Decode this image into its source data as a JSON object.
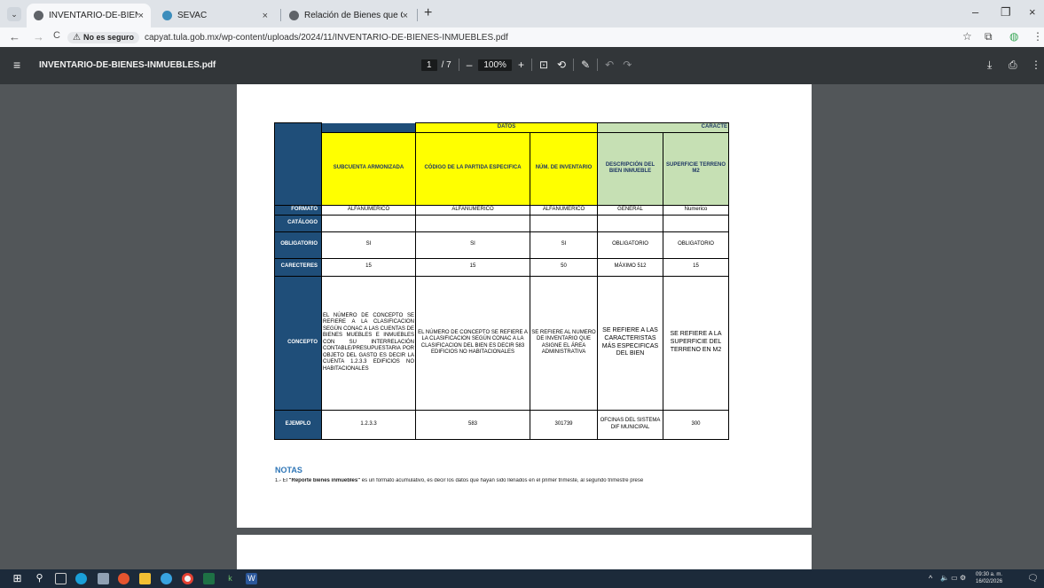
{
  "browser": {
    "tabs": [
      {
        "title": "INVENTARIO-DE-BIENES-INMU",
        "close": "×",
        "favicon_color": "#5f6368",
        "active": true
      },
      {
        "title": "SEVAC",
        "close": "×",
        "favicon_color": "#3c8dbc",
        "active": false
      },
      {
        "title": "Relación de Bienes que Compo",
        "close": "×",
        "favicon_color": "#5f6368",
        "active": false
      }
    ],
    "new_tab": "+",
    "window_controls": {
      "minimize": "–",
      "restore": "❐",
      "close": "×"
    },
    "nav": {
      "back": "←",
      "forward": "→",
      "reload": "C"
    },
    "security_chip": {
      "icon": "⚠",
      "label": "No es seguro"
    },
    "url": "capyat.tula.gob.mx/wp-content/uploads/2024/11/INVENTARIO-DE-BIENES-INMUEBLES.pdf",
    "toolbar_icons": {
      "star": "☆",
      "extensions": "⧉",
      "profile": "◍",
      "menu": "⋮"
    }
  },
  "pdf_viewer": {
    "menu_icon": "≡",
    "filename": "INVENTARIO-DE-BIENES-INMUEBLES.pdf",
    "page_current": "1",
    "page_total": "/ 7",
    "zoom_out": "–",
    "zoom": "100%",
    "zoom_in": "+",
    "fit_icon": "⊡",
    "rotate_icon": "⟲",
    "annotate_icon": "✎",
    "undo_icon": "↶",
    "redo_icon": "↷",
    "download_icon": "⤓",
    "print_icon": "⎙",
    "more_icon": "⋮"
  },
  "document": {
    "group_header_datos": "DATOS",
    "group_header_caract": "CARACTE",
    "columns": [
      "SUBCUENTA ARMONIZADA",
      "CÓDIGO DE LA PARTIDA ESPECIFICA",
      "NÚM. DE INVENTARIO",
      "DESCRIPCIÓN DEL BIEN INMUEBLE",
      "SUPERFICIE TERRENO M2"
    ],
    "rows": [
      {
        "label": "FORMATO",
        "cells": [
          "ALFANÚMERICO",
          "ALFANÚMERICO",
          "ALFANÚMERICO",
          "GENERAL",
          "Numerico"
        ]
      },
      {
        "label": "CATÁLOGO",
        "cells": [
          "",
          "",
          "",
          "",
          ""
        ]
      },
      {
        "label": "OBLIGATORIO",
        "cells": [
          "SI",
          "SI",
          "SI",
          "OBLIGATORIO",
          "OBLIGATORIO"
        ]
      },
      {
        "label": "CARECTERES",
        "cells": [
          "15",
          "15",
          "50",
          "MÁXIMO 512",
          "15"
        ]
      },
      {
        "label": "CONCEPTO",
        "cells": [
          "EL NÚMERO DE CONCEPTO SE REFIERE A LA CLASIFICACION SEGÚN CONAC A LAS CUENTAS DE BIENES MUEBLES E INMUEBLES CON SU INTERRELACIÓN CONTABLE/PRESUPUESTARIA POR OBJETO DEL GASTO ES DECIR LA CUENTA 1.2.3.3 EDIFICIOS NO HABITACIONALES",
          "EL NÚMERO DE CONCEPTO SE REFIERE A LA CLASIFICACION SEGÚN CONAC A LA CLASIFICACION DEL BIEN ES DECIR 583 EDIFICIOS NO HABITACIONALES",
          "SE REFIERE AL NUMERO DE INVENTARIO QUE ASIGNE EL ÁREA ADMINISTRATIVA",
          "SE REFIERE A LAS CARACTERISTAS MÁS ESPECIFICAS DEL BIEN",
          "SE REFIERE A LA SUPERFICIE DEL TERRENO EN M2"
        ]
      },
      {
        "label": "EJEMPLO",
        "cells": [
          "1.2.3.3",
          "583",
          "301739",
          "OFCINAS DEL SISTEMA DIF MUNICIPAL",
          "300"
        ]
      }
    ],
    "notes_title": "NOTAS",
    "notes_prefix": "1.- El ",
    "notes_bold": "\"Reporte bienes inmuebles\"",
    "notes_rest": " es un formato acumulativo, es decir los datos que hayan sido llenados en el primer trimeste, al segundo trimestre prese"
  },
  "taskbar": {
    "start_icon": "⊞",
    "search_icon": "⚲",
    "tray_chevron": "^",
    "tray_icons": "🔈 ▭ ⚙",
    "time": "09:30 a. m.",
    "date": "16/02/2026",
    "notification_icon": "🗨"
  }
}
